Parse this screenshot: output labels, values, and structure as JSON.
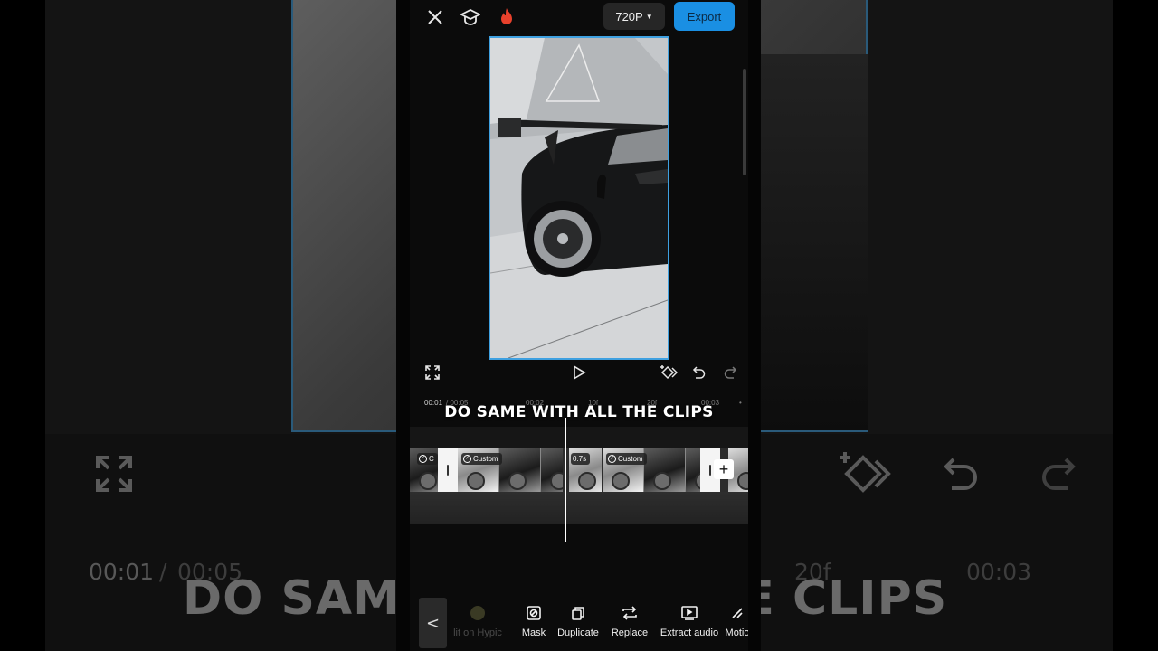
{
  "background_mirror": {
    "time_current": "00:01",
    "time_separator": "/",
    "time_total": "00:05",
    "frame_marker": "20f",
    "time_mark": "00:03",
    "caption_left": "DO SAMI",
    "caption_right": "IE CLIPS"
  },
  "top_bar": {
    "resolution_label": "720P",
    "export_label": "Export",
    "icons": [
      "close-icon",
      "tutorial-cap-icon",
      "flame-icon"
    ]
  },
  "controls": {
    "icons": [
      "fullscreen-icon",
      "play-icon",
      "keyframe-icon",
      "undo-icon",
      "redo-icon"
    ]
  },
  "ruler": {
    "current_time": "00:01",
    "total_time": "/ 00:05",
    "marks": [
      "00:02",
      "10f",
      "20f",
      "00:03"
    ]
  },
  "caption": "DO SAME WITH ALL THE CLIPS",
  "timeline": {
    "clips": [
      {
        "badge": "C"
      },
      {
        "badge": "Custom"
      },
      {
        "badge": "0.7s"
      },
      {
        "badge": "Custom"
      }
    ],
    "add_label": "+"
  },
  "toolbar": {
    "back_label": "<",
    "tools": [
      {
        "label": "lit on Hypic",
        "icon": "hypic-icon",
        "disabled": true
      },
      {
        "label": "Mask",
        "icon": "mask-icon"
      },
      {
        "label": "Duplicate",
        "icon": "duplicate-icon"
      },
      {
        "label": "Replace",
        "icon": "replace-icon"
      },
      {
        "label": "Extract audio",
        "icon": "extract-audio-icon"
      },
      {
        "label": "Motio",
        "icon": "motion-icon"
      }
    ]
  },
  "colors": {
    "accent": "#1a8fe3",
    "preview_border": "#3ea0e0",
    "background": "#0b0b0b"
  }
}
